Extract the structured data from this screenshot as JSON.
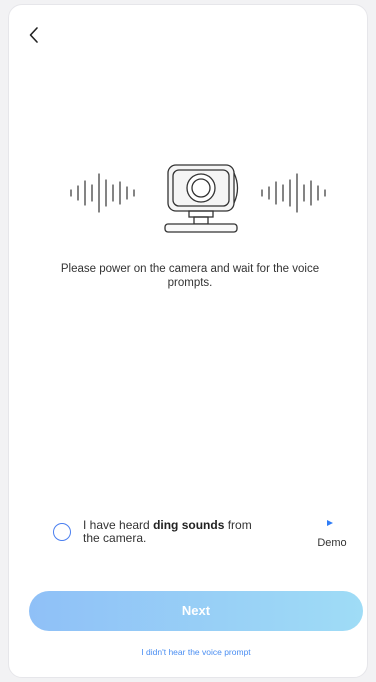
{
  "instruction_text": "Please power on the camera and wait for the voice prompts.",
  "confirm": {
    "text_before": "I have heard ",
    "text_bold": "ding sounds",
    "text_after": " from the camera."
  },
  "demo": {
    "label": "Demo"
  },
  "next_button": {
    "label": "Next"
  },
  "help_link": {
    "label": "I didn't hear the voice prompt"
  },
  "colors": {
    "accent": "#4a7ff0",
    "button_gradient_start": "#8fc0f7",
    "button_gradient_end": "#9fdcf6",
    "link": "#4a8ef2"
  },
  "icons": {
    "back": "chevron-left-icon",
    "illustration": "camera-icon",
    "sound_waves": "sound-wave-icon",
    "demo": "play-icon"
  }
}
